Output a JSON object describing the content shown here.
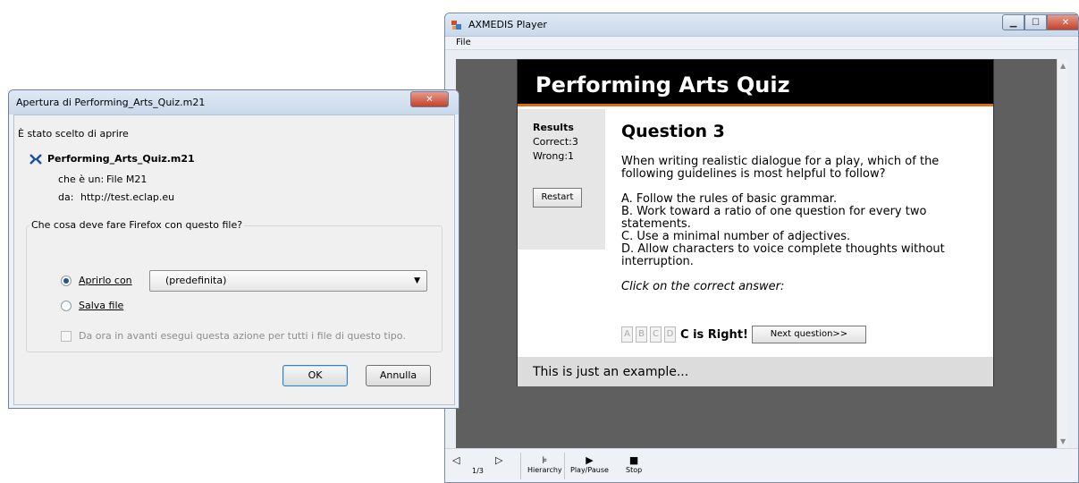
{
  "player": {
    "title": "AXMEDIS Player",
    "menu": [
      "File"
    ],
    "quiz": {
      "header": "Performing Arts Quiz",
      "results_label": "Results",
      "correct": "Correct:3",
      "wrong": "Wrong:1",
      "restart_label": "Restart",
      "question_title": "Question 3",
      "question_text": "When writing realistic dialogue for a play, which of the following guidelines is most helpful to follow?",
      "options": [
        "A. Follow the rules of basic grammar.",
        "B. Work toward a ratio of one question for every two statements.",
        "C. Use a minimal number of adjectives.",
        "D. Allow characters to voice complete thoughts without interruption."
      ],
      "prompt": "Click on the correct answer:",
      "answer_buttons": [
        "A",
        "B",
        "C",
        "D"
      ],
      "result_text": "C is Right!",
      "next_label": "Next question>>",
      "footer": "This is just an example..."
    },
    "toolbar": {
      "page": "1/3",
      "hierarchy": "Hierarchy",
      "play_pause": "Play/Pause",
      "stop": "Stop"
    }
  },
  "dialog": {
    "title": "Apertura di Performing_Arts_Quiz.m21",
    "intro": "È stato scelto di aprire",
    "filename": "Performing_Arts_Quiz.m21",
    "type_label": "che è un:",
    "type_value": "File M21",
    "from_label": "da:",
    "from_value": "http://test.eclap.eu",
    "question": "Che cosa deve fare Firefox con questo file?",
    "open_with_label": "Aprirlo con",
    "open_with_value": "(predefinita)",
    "save_label": "Salva file",
    "always_label": "Da ora in avanti esegui questa azione per tutti i file di questo tipo.",
    "ok_label": "OK",
    "cancel_label": "Annulla"
  }
}
